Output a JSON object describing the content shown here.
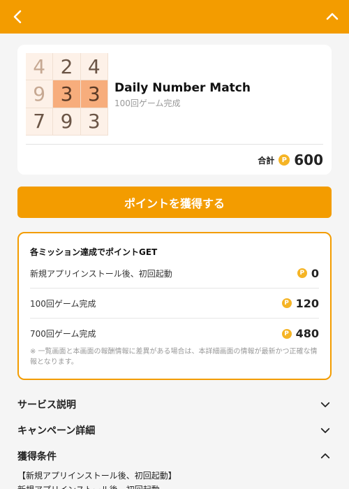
{
  "header": {
    "back_icon": "chevron-left-icon",
    "collapse_icon": "chevron-up-icon",
    "bg_color": "#f39c00"
  },
  "app": {
    "title": "Daily Number Match",
    "subtitle": "100回ゲーム完成",
    "thumbnail_grid": [
      "4",
      "2",
      "4",
      "9",
      "3",
      "3",
      "7",
      "9",
      "3"
    ],
    "total_label": "合計",
    "total_points": "600"
  },
  "cta": {
    "label": "ポイントを獲得する"
  },
  "missions": {
    "title": "各ミッション達成でポイントGET",
    "items": [
      {
        "label": "新規アプリインストール後、初回起動",
        "points": "0"
      },
      {
        "label": "100回ゲーム完成",
        "points": "120"
      },
      {
        "label": "700回ゲーム完成",
        "points": "480"
      }
    ],
    "note": "※ 一覧画面と本画面の報酬情報に差異がある場合は、本詳細画面の情報が最新かつ正確な情報となります。"
  },
  "sections": [
    {
      "label": "サービス説明",
      "icon": "chevron-down-icon"
    },
    {
      "label": "キャンペーン詳細",
      "icon": "chevron-down-icon"
    },
    {
      "label": "獲得条件",
      "icon": "chevron-up-icon"
    }
  ],
  "conditions": {
    "line1": "【新規アプリインストール後、初回起動】",
    "line2": "新規アプリインストール後、初回起動"
  },
  "coin_symbol": "P",
  "accent_color": "#f39c00"
}
